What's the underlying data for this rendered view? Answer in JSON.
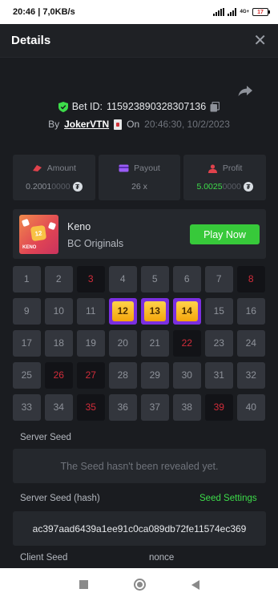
{
  "status": {
    "time": "20:46",
    "speed": "7,0KB/s",
    "network": "4G+",
    "battery": "17"
  },
  "header": {
    "title": "Details",
    "close_icon": "close-icon"
  },
  "bet": {
    "bet_id_label": "Bet ID:",
    "bet_id": "115923890328307136",
    "by_label": "By",
    "user": "JokerVTN",
    "on_label": "On",
    "datetime": "20:46:30, 10/2/2023"
  },
  "stats": {
    "amount": {
      "label": "Amount",
      "value_main": "0.2001",
      "value_dim": "0000",
      "currency_icon": "tether-icon"
    },
    "payout": {
      "label": "Payout",
      "value": "26 x"
    },
    "profit": {
      "label": "Profit",
      "value_main": "5.0025",
      "value_dim": "0000",
      "currency_icon": "tether-icon"
    }
  },
  "game": {
    "name": "Keno",
    "provider": "BC Originals",
    "play_label": "Play Now",
    "logo_number": "12",
    "logo_word": "KENO"
  },
  "board": {
    "numbers": [
      1,
      2,
      3,
      4,
      5,
      6,
      7,
      8,
      9,
      10,
      11,
      12,
      13,
      14,
      15,
      16,
      17,
      18,
      19,
      20,
      21,
      22,
      23,
      24,
      25,
      26,
      27,
      28,
      29,
      30,
      31,
      32,
      33,
      34,
      35,
      36,
      37,
      38,
      39,
      40
    ],
    "hits": [
      12,
      13,
      14
    ],
    "misses": [
      3,
      8,
      22,
      26,
      27,
      35,
      39
    ],
    "colors": {
      "hit_border": "#7b2fe0",
      "miss_text": "#d22c3a",
      "cell_bg": "#33363d"
    }
  },
  "seeds": {
    "server_seed_label": "Server Seed",
    "server_seed_value": "The Seed hasn't been revealed yet.",
    "server_hash_label": "Server Seed (hash)",
    "seed_settings_label": "Seed Settings",
    "server_hash_value": "ac397aad6439a1ee91c0ca089db72fe11574ec369",
    "client_seed_label": "Client Seed",
    "nonce_label": "nonce"
  },
  "accent_colors": {
    "green": "#3ddc4a",
    "play_button": "#37c93a",
    "red": "#d22c3a"
  }
}
